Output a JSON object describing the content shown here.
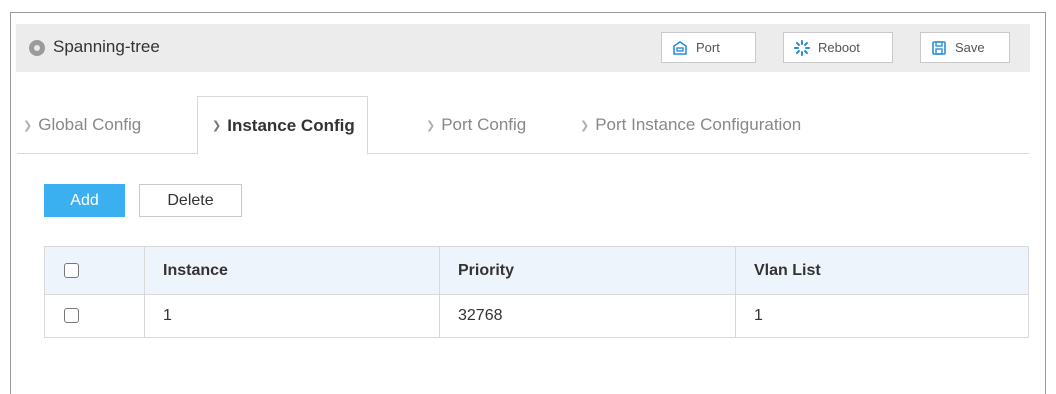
{
  "header": {
    "title": "Spanning-tree",
    "buttons": {
      "port": "Port",
      "reboot": "Reboot",
      "save": "Save"
    }
  },
  "tabs": [
    {
      "label": "Global Config",
      "active": false
    },
    {
      "label": "Instance Config",
      "active": true
    },
    {
      "label": "Port Config",
      "active": false
    },
    {
      "label": "Port Instance Configuration",
      "active": false
    }
  ],
  "toolbar": {
    "add_label": "Add",
    "delete_label": "Delete"
  },
  "table": {
    "columns": [
      "Instance",
      "Priority",
      "Vlan List"
    ],
    "rows": [
      {
        "instance": "1",
        "priority": "32768",
        "vlan_list": "1"
      }
    ]
  },
  "colors": {
    "accent": "#3ab0f0",
    "header_bg": "#ececec",
    "table_header_bg": "#eef4fb"
  }
}
